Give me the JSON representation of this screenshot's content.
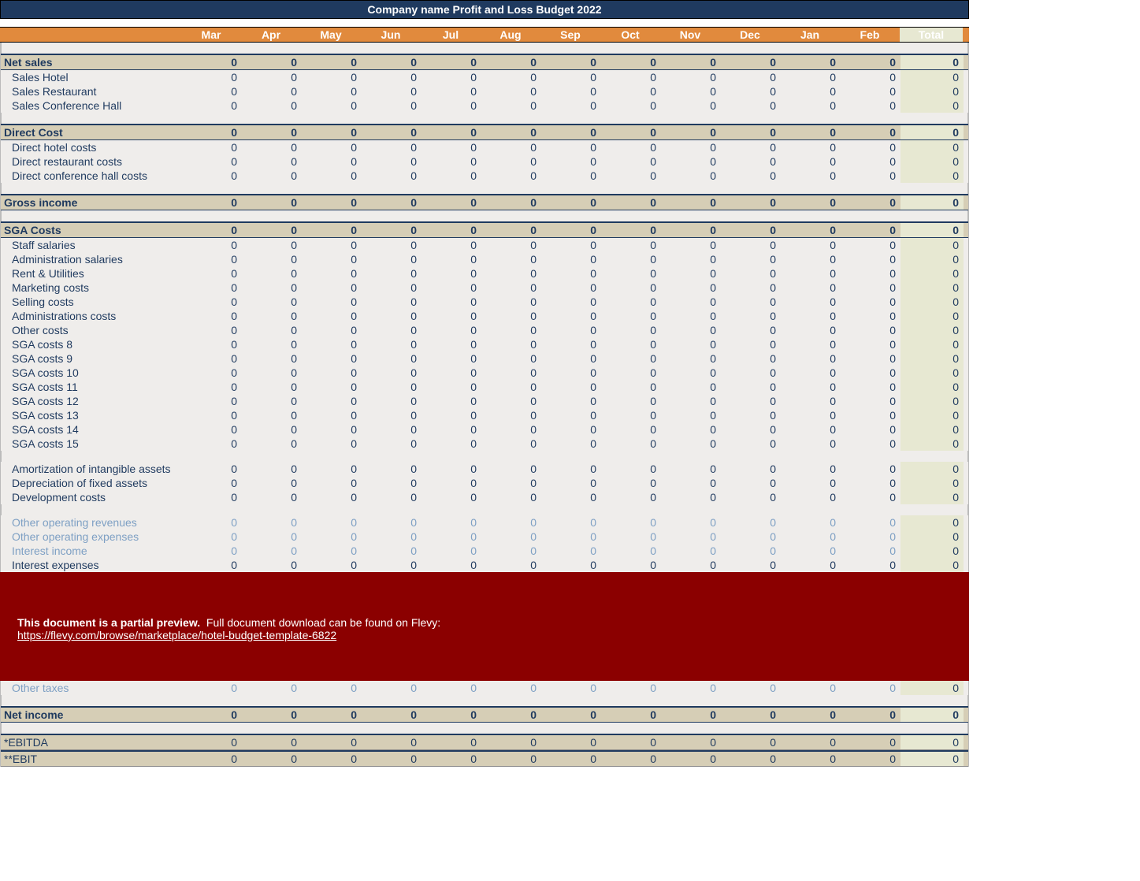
{
  "title": "Company name Profit and Loss Budget 2022",
  "months": [
    "Mar",
    "Apr",
    "May",
    "Jun",
    "Jul",
    "Aug",
    "Sep",
    "Oct",
    "Nov",
    "Dec",
    "Jan",
    "Feb",
    "Total"
  ],
  "sections": [
    {
      "name": "Net sales",
      "rows": [
        {
          "label": "Sales Hotel"
        },
        {
          "label": "Sales Restaurant"
        },
        {
          "label": "Sales Conference Hall"
        }
      ]
    },
    {
      "name": "Direct Cost",
      "rows": [
        {
          "label": "Direct hotel costs"
        },
        {
          "label": "Direct restaurant costs"
        },
        {
          "label": "Direct conference hall costs"
        }
      ]
    },
    {
      "name": "Gross income",
      "rows": []
    },
    {
      "name": "SGA Costs",
      "rows": [
        {
          "label": "Staff salaries"
        },
        {
          "label": "Administration salaries"
        },
        {
          "label": "Rent & Utilities"
        },
        {
          "label": "Marketing costs"
        },
        {
          "label": "Selling costs"
        },
        {
          "label": "Administrations costs"
        },
        {
          "label": "Other costs"
        },
        {
          "label": "SGA costs 8"
        },
        {
          "label": "SGA costs 9"
        },
        {
          "label": "SGA costs 10"
        },
        {
          "label": "SGA costs 11"
        },
        {
          "label": "SGA costs 12"
        },
        {
          "label": "SGA costs 13"
        },
        {
          "label": "SGA costs 14"
        },
        {
          "label": "SGA costs 15"
        }
      ]
    }
  ],
  "extra_rows_1": [
    {
      "label": "Amortization of intangible assets"
    },
    {
      "label": "Depreciation of fixed assets"
    },
    {
      "label": "Development costs"
    }
  ],
  "extra_rows_2": [
    {
      "label": "Other operating revenues",
      "light": true
    },
    {
      "label": "Other operating expenses",
      "light": true
    },
    {
      "label": "Interest income",
      "light": true
    },
    {
      "label": "Interest expenses"
    }
  ],
  "other_taxes": {
    "label": "Other taxes",
    "light": true
  },
  "net_income": "Net income",
  "footer_rows": [
    {
      "label": "*EBITDA"
    },
    {
      "label": "**EBIT"
    }
  ],
  "overlay": {
    "bold": "This document is a partial preview.",
    "text": "Full document download can be found on Flevy:",
    "url": "https://flevy.com/browse/marketplace/hotel-budget-template-6822"
  },
  "zero": "0"
}
